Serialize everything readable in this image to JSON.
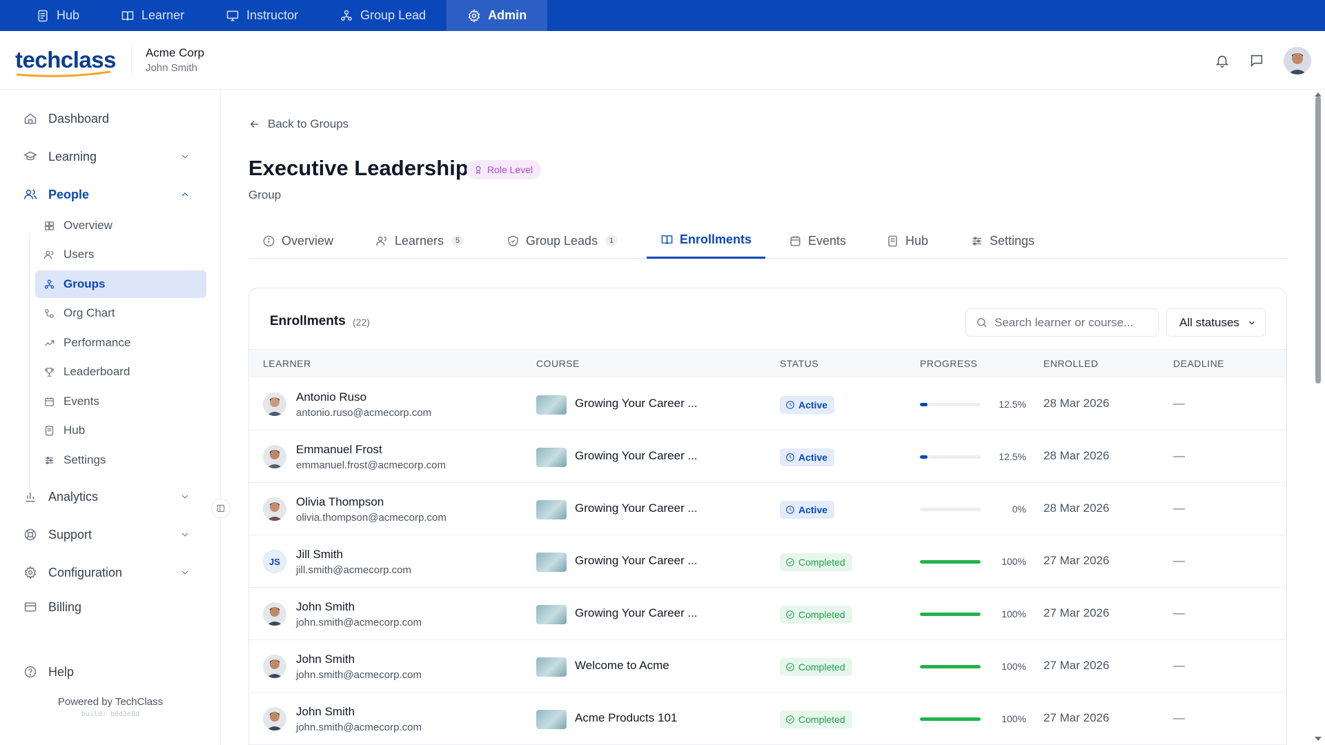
{
  "topbar": {
    "tabs": [
      {
        "label": "Hub",
        "icon": "hub-icon"
      },
      {
        "label": "Learner",
        "icon": "book-icon"
      },
      {
        "label": "Instructor",
        "icon": "presentation-icon"
      },
      {
        "label": "Group Lead",
        "icon": "group-icon"
      },
      {
        "label": "Admin",
        "icon": "gear-icon",
        "active": true
      }
    ]
  },
  "header": {
    "logo": "techclass",
    "org_name": "Acme Corp",
    "user_name": "John Smith"
  },
  "sidebar": {
    "items": {
      "dashboard": "Dashboard",
      "learning": "Learning",
      "people": "People",
      "analytics": "Analytics",
      "support": "Support",
      "configuration": "Configuration",
      "billing": "Billing",
      "help": "Help"
    },
    "people_sub": {
      "overview": "Overview",
      "users": "Users",
      "groups": "Groups",
      "org_chart": "Org Chart",
      "performance": "Performance",
      "leaderboard": "Leaderboard",
      "events": "Events",
      "hub": "Hub",
      "settings": "Settings"
    },
    "powered": "Powered by TechClass",
    "build": "build: b0d3e8d"
  },
  "page": {
    "back_label": "Back to Groups",
    "title": "Executive Leadership",
    "badge": "Role Level",
    "subtitle": "Group"
  },
  "tabs": {
    "overview": "Overview",
    "learners": "Learners",
    "learners_count": "5",
    "group_leads": "Group Leads",
    "group_leads_count": "1",
    "enrollments": "Enrollments",
    "events": "Events",
    "hub": "Hub",
    "settings": "Settings"
  },
  "enrollments": {
    "title": "Enrollments",
    "count": "(22)",
    "search_placeholder": "Search learner or course...",
    "status_filter": "All statuses",
    "columns": {
      "learner": "LEARNER",
      "course": "COURSE",
      "status": "STATUS",
      "progress": "PROGRESS",
      "enrolled": "ENROLLED",
      "deadline": "DEADLINE"
    },
    "rows": [
      {
        "name": "Antonio Ruso",
        "email": "antonio.ruso@acmecorp.com",
        "course": "Growing Your Career ...",
        "status": "Active",
        "progress": 12.5,
        "progress_label": "12.5%",
        "enrolled": "28 Mar 2026",
        "deadline": "—"
      },
      {
        "name": "Emmanuel Frost",
        "email": "emmanuel.frost@acmecorp.com",
        "course": "Growing Your Career ...",
        "status": "Active",
        "progress": 12.5,
        "progress_label": "12.5%",
        "enrolled": "28 Mar 2026",
        "deadline": "—"
      },
      {
        "name": "Olivia Thompson",
        "email": "olivia.thompson@acmecorp.com",
        "course": "Growing Your Career ...",
        "status": "Active",
        "progress": 0,
        "progress_label": "0%",
        "enrolled": "28 Mar 2026",
        "deadline": "—"
      },
      {
        "name": "Jill Smith",
        "email": "jill.smith@acmecorp.com",
        "initials": "JS",
        "course": "Growing Your Career ...",
        "status": "Completed",
        "progress": 100,
        "progress_label": "100%",
        "enrolled": "27 Mar 2026",
        "deadline": "—"
      },
      {
        "name": "John Smith",
        "email": "john.smith@acmecorp.com",
        "course": "Growing Your Career ...",
        "status": "Completed",
        "progress": 100,
        "progress_label": "100%",
        "enrolled": "27 Mar 2026",
        "deadline": "—"
      },
      {
        "name": "John Smith",
        "email": "john.smith@acmecorp.com",
        "course": "Welcome to Acme",
        "status": "Completed",
        "progress": 100,
        "progress_label": "100%",
        "enrolled": "27 Mar 2026",
        "deadline": "—"
      },
      {
        "name": "John Smith",
        "email": "john.smith@acmecorp.com",
        "course": "Acme Products 101",
        "status": "Completed",
        "progress": 100,
        "progress_label": "100%",
        "enrolled": "27 Mar 2026",
        "deadline": "—"
      }
    ]
  },
  "colors": {
    "brand_blue": "#0a47b8",
    "progress_active": "#0a47b8",
    "progress_done": "#22b14c"
  }
}
